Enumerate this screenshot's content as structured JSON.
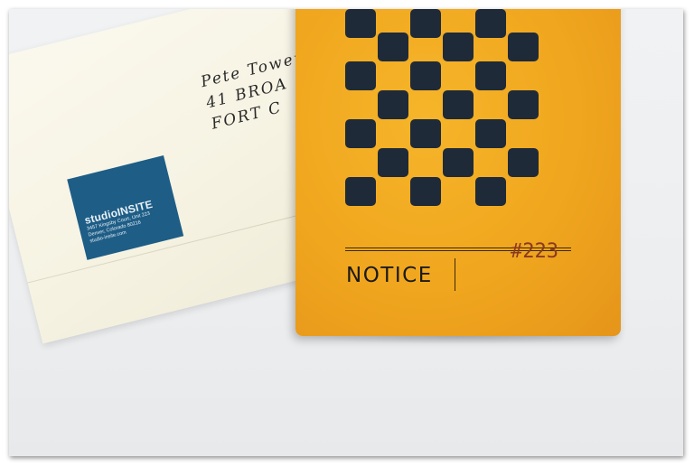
{
  "photo": {
    "envelope": {
      "label": {
        "brand": "studioINSITE",
        "address_line1": "3457 Kingsby Court, Unit 223",
        "address_line2": "Denver, Colorado 80216",
        "website": "studio-insite.com"
      },
      "handwriting": {
        "line1": "Pete Tower",
        "line2": "41 BROA",
        "line3": "FORT C"
      }
    },
    "card": {
      "title": "NOTICE",
      "number": "#223",
      "colors": {
        "card": "#f0a61e",
        "squares": "#1f2a39",
        "label_blue": "#1e5d86"
      }
    }
  }
}
